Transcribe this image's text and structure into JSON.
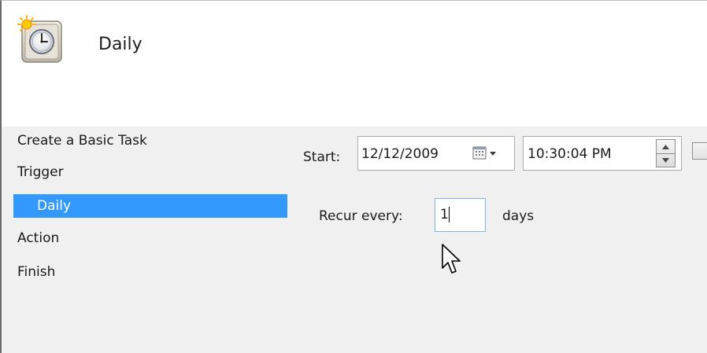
{
  "header": {
    "title": "Daily",
    "icon": "scheduled-task-clock-icon"
  },
  "nav": {
    "items": [
      {
        "label": "Create a Basic Task",
        "selected": false
      },
      {
        "label": "Trigger",
        "selected": false
      },
      {
        "label": "Daily",
        "selected": true
      },
      {
        "label": "Action",
        "selected": false
      },
      {
        "label": "Finish",
        "selected": false
      }
    ]
  },
  "trigger": {
    "start_label": "Start:",
    "start_date": "12/12/2009",
    "start_time": "10:30:04 PM",
    "recur_label": "Recur every:",
    "recur_value": "1",
    "recur_unit": "days"
  },
  "colors": {
    "selection": "#3399ff",
    "panel": "#f0f0f0",
    "focus_border": "#7eb4ea"
  }
}
